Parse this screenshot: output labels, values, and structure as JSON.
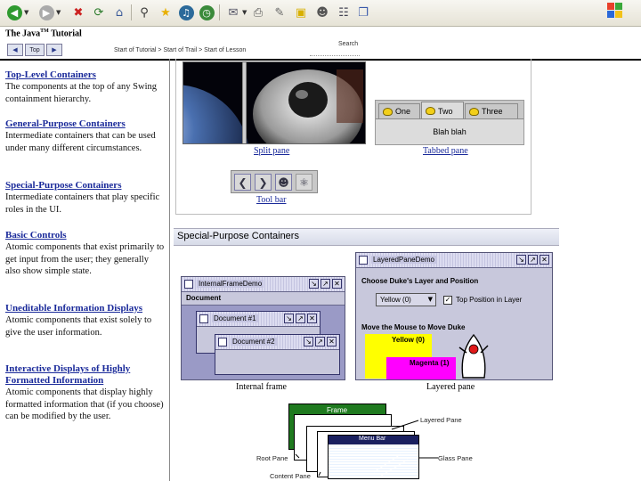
{
  "browser": {
    "toolbar_icons": [
      "back-icon",
      "forward-icon",
      "stop-icon",
      "refresh-icon",
      "home-icon",
      "search-icon",
      "favorites-icon",
      "media-icon",
      "history-icon",
      "mail-icon",
      "print-icon",
      "edit-icon",
      "discuss-icon",
      "messenger-icon",
      "research-icon",
      "windows-logo-icon"
    ]
  },
  "header": {
    "title": "The Java",
    "title_tm": "TM",
    "title_suffix": " Tutorial",
    "prev_label": "",
    "top_label": "Top",
    "next_label": "",
    "breadcrumbs": "Start of Tutorial > Start of Trail > Start of Lesson",
    "search_label": "Search"
  },
  "sidebar": {
    "items": [
      {
        "title": "Top-Level Containers",
        "desc": "The components at the top of any Swing containment hierarchy."
      },
      {
        "title": "General-Purpose Containers",
        "desc": "Intermediate containers that can be used under many different circumstances."
      },
      {
        "title": "Special-Purpose Containers",
        "desc": "Intermediate containers that play specific roles in the UI."
      },
      {
        "title": "Basic Controls",
        "desc": "Atomic components that exist primarily to get input from the user; they generally also show simple state."
      },
      {
        "title": "Uneditable Information Displays",
        "desc": "Atomic components that exist solely to give the user information."
      },
      {
        "title": "Interactive Displays of Highly Formatted Information",
        "desc": "Atomic components that display highly formatted information that (if you choose) can be modified by the user."
      }
    ]
  },
  "main": {
    "split_pane_caption": "Split pane",
    "tabbed_pane_caption": "Tabbed pane",
    "tabs": [
      "One",
      "Two",
      "Three"
    ],
    "tab_content": "Blah blah",
    "tool_bar_caption": "Tool bar",
    "section_title": "Special-Purpose Containers",
    "internal_frame": {
      "window_title": "InternalFrameDemo",
      "menu": "Document",
      "doc1": "Document #1",
      "doc2": "Document #2",
      "caption": "Internal frame"
    },
    "layered_pane": {
      "window_title": "LayeredPaneDemo",
      "group1": "Choose Duke's Layer and Position",
      "combo_value": "Yellow (0)",
      "checkbox_label": "Top Position in Layer",
      "group2": "Move the Mouse to Move Duke",
      "yellow_label": "Yellow (0)",
      "magenta_label": "Magenta (1)",
      "caption": "Layered pane"
    },
    "root_pane_diagram": {
      "frame": "Frame",
      "menu_bar": "Menu Bar",
      "layered_pane": "Layered Pane",
      "glass_pane": "Glass Pane",
      "root_pane": "Root Pane",
      "content_pane": "Content Pane"
    }
  },
  "colors": {
    "link": "#1a2a9a",
    "java_frame": "#9a9ac6",
    "yellow_layer": "#ffff00",
    "magenta_layer": "#ff00ff",
    "frame_green": "#1f7a1f",
    "menubar_navy": "#1a2060"
  }
}
